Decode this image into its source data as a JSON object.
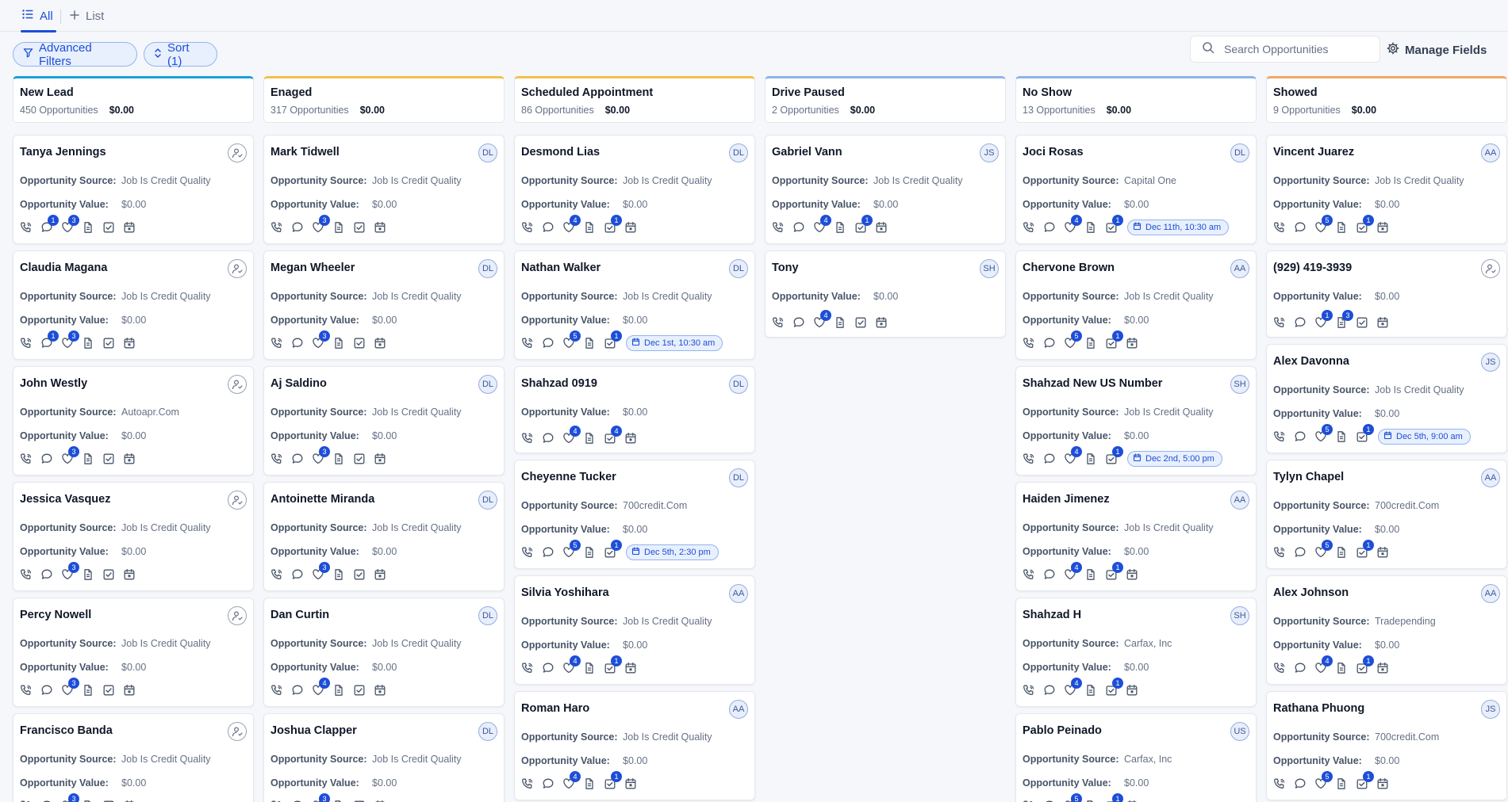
{
  "tabs": [
    {
      "label": "All",
      "icon": "list-icon",
      "active": true
    },
    {
      "label": "List",
      "icon": "plus-icon",
      "active": false
    }
  ],
  "toolbar": {
    "filters_label": "Advanced Filters",
    "sort_label": "Sort (1)",
    "search_placeholder": "Search Opportunities",
    "manage_label": "Manage Fields"
  },
  "labels": {
    "source": "Opportunity Source:",
    "value": "Opportunity Value:"
  },
  "colors": {
    "accent": "#1d4ed8",
    "badge": "#1d4ed8"
  },
  "columns": [
    {
      "title": "New Lead",
      "count": "450 Opportunities",
      "amount": "$0.00",
      "color": "#1aa0d8",
      "cards": [
        {
          "name": "Tanya Jennings",
          "avatar": "",
          "source": "Job Is Credit Quality",
          "value": "$0.00",
          "icons": [
            "phone",
            "chat:1",
            "heart:3",
            "doc",
            "check",
            "calendar"
          ]
        },
        {
          "name": "Claudia Magana",
          "avatar": "",
          "source": "Job Is Credit Quality",
          "value": "$0.00",
          "icons": [
            "phone",
            "chat:1",
            "heart:3",
            "doc",
            "check",
            "calendar"
          ]
        },
        {
          "name": "John Westly",
          "avatar": "",
          "source": "Autoapr.Com",
          "value": "$0.00",
          "icons": [
            "phone",
            "chat",
            "heart:3",
            "doc",
            "check",
            "calendar"
          ]
        },
        {
          "name": "Jessica Vasquez",
          "avatar": "",
          "source": "Job Is Credit Quality",
          "value": "$0.00",
          "icons": [
            "phone",
            "chat",
            "heart:3",
            "doc",
            "check",
            "calendar"
          ]
        },
        {
          "name": "Percy Nowell",
          "avatar": "",
          "source": "Job Is Credit Quality",
          "value": "$0.00",
          "icons": [
            "phone",
            "chat",
            "heart:3",
            "doc",
            "check",
            "calendar"
          ]
        },
        {
          "name": "Francisco Banda",
          "avatar": "",
          "source": "Job Is Credit Quality",
          "value": "$0.00",
          "icons": [
            "phone",
            "chat",
            "heart:3",
            "doc",
            "check",
            "calendar"
          ]
        }
      ]
    },
    {
      "title": "Enaged",
      "count": "317 Opportunities",
      "amount": "$0.00",
      "color": "#f2c14e",
      "cards": [
        {
          "name": "Mark Tidwell",
          "avatar": "DL",
          "source": "Job Is Credit Quality",
          "value": "$0.00",
          "icons": [
            "phone",
            "chat",
            "heart:3",
            "doc",
            "check",
            "calendar"
          ]
        },
        {
          "name": "Megan Wheeler",
          "avatar": "DL",
          "source": "Job Is Credit Quality",
          "value": "$0.00",
          "icons": [
            "phone",
            "chat",
            "heart:3",
            "doc",
            "check",
            "calendar"
          ]
        },
        {
          "name": "Aj Saldino",
          "avatar": "DL",
          "source": "Job Is Credit Quality",
          "value": "$0.00",
          "icons": [
            "phone",
            "chat",
            "heart:3",
            "doc",
            "check",
            "calendar"
          ]
        },
        {
          "name": "Antoinette Miranda",
          "avatar": "DL",
          "source": "Job Is Credit Quality",
          "value": "$0.00",
          "icons": [
            "phone",
            "chat",
            "heart:3",
            "doc",
            "check",
            "calendar"
          ]
        },
        {
          "name": "Dan Curtin",
          "avatar": "DL",
          "source": "Job Is Credit Quality",
          "value": "$0.00",
          "icons": [
            "phone",
            "chat",
            "heart:4",
            "doc",
            "check",
            "calendar"
          ]
        },
        {
          "name": "Joshua Clapper",
          "avatar": "DL",
          "source": "Job Is Credit Quality",
          "value": "$0.00",
          "icons": [
            "phone",
            "chat",
            "heart:3",
            "doc",
            "check",
            "calendar"
          ]
        }
      ]
    },
    {
      "title": "Scheduled Appointment",
      "count": "86 Opportunities",
      "amount": "$0.00",
      "color": "#f2c14e",
      "cards": [
        {
          "name": "Desmond Lias",
          "avatar": "DL",
          "source": "Job Is Credit Quality",
          "value": "$0.00",
          "icons": [
            "phone",
            "chat",
            "heart:4",
            "doc",
            "task:1",
            "calendar"
          ]
        },
        {
          "name": "Nathan Walker",
          "avatar": "DL",
          "source": "Job Is Credit Quality",
          "value": "$0.00",
          "icons": [
            "phone",
            "chat",
            "heart:5",
            "doc",
            "task:1"
          ],
          "appt": "Dec 1st, 10:30 am"
        },
        {
          "name": "Shahzad 0919",
          "avatar": "DL",
          "value": "$0.00",
          "icons": [
            "phone",
            "chat",
            "heart:4",
            "doc",
            "task:4",
            "calendar"
          ]
        },
        {
          "name": "Cheyenne Tucker",
          "avatar": "DL",
          "source": "700credit.Com",
          "value": "$0.00",
          "icons": [
            "phone",
            "chat",
            "heart:5",
            "doc",
            "task:1"
          ],
          "appt": "Dec 5th, 2:30 pm"
        },
        {
          "name": "Silvia Yoshihara",
          "avatar": "AA",
          "source": "Job Is Credit Quality",
          "value": "$0.00",
          "icons": [
            "phone",
            "chat",
            "heart:4",
            "doc",
            "task:1",
            "calendar"
          ]
        },
        {
          "name": "Roman Haro",
          "avatar": "AA",
          "source": "Job Is Credit Quality",
          "value": "$0.00",
          "icons": [
            "phone",
            "chat",
            "heart:4",
            "doc",
            "task:1",
            "calendar"
          ]
        }
      ]
    },
    {
      "title": "Drive Paused",
      "count": "2 Opportunities",
      "amount": "$0.00",
      "color": "#8fb4e8",
      "cards": [
        {
          "name": "Gabriel Vann",
          "avatar": "JS",
          "source": "Job Is Credit Quality",
          "value": "$0.00",
          "icons": [
            "phone",
            "chat",
            "heart:4",
            "doc",
            "task:1",
            "calendar"
          ]
        },
        {
          "name": "Tony",
          "avatar": "SH",
          "value": "$0.00",
          "icons": [
            "phone",
            "chat",
            "heart:4",
            "doc",
            "check",
            "calendar"
          ]
        }
      ]
    },
    {
      "title": "No Show",
      "count": "13 Opportunities",
      "amount": "$0.00",
      "color": "#8fb4e8",
      "cards": [
        {
          "name": "Joci Rosas",
          "avatar": "DL",
          "source": "Capital One",
          "value": "$0.00",
          "icons": [
            "phone",
            "chat",
            "heart:4",
            "doc",
            "task:1"
          ],
          "appt": "Dec 11th, 10:30 am"
        },
        {
          "name": "Chervone Brown",
          "avatar": "AA",
          "source": "Job Is Credit Quality",
          "value": "$0.00",
          "icons": [
            "phone",
            "chat",
            "heart:5",
            "doc",
            "task:1",
            "calendar"
          ]
        },
        {
          "name": "Shahzad New US Number",
          "avatar": "SH",
          "source": "Job Is Credit Quality",
          "value": "$0.00",
          "icons": [
            "phone",
            "chat",
            "heart:4",
            "doc",
            "task:1"
          ],
          "appt": "Dec 2nd, 5:00 pm"
        },
        {
          "name": "Haiden Jimenez",
          "avatar": "AA",
          "source": "Job Is Credit Quality",
          "value": "$0.00",
          "icons": [
            "phone",
            "chat",
            "heart:4",
            "doc",
            "task:1",
            "calendar"
          ]
        },
        {
          "name": "Shahzad H",
          "avatar": "SH",
          "source": "Carfax, Inc",
          "value": "$0.00",
          "icons": [
            "phone",
            "chat",
            "heart:4",
            "doc",
            "task:1",
            "calendar"
          ]
        },
        {
          "name": "Pablo Peinado",
          "avatar": "US",
          "source": "Carfax, Inc",
          "value": "$0.00",
          "icons": [
            "phone",
            "chat",
            "heart:5",
            "doc",
            "task:1",
            "calendar"
          ]
        }
      ]
    },
    {
      "title": "Showed",
      "count": "9 Opportunities",
      "amount": "$0.00",
      "color": "#f0a868",
      "cards": [
        {
          "name": "Vincent Juarez",
          "avatar": "AA",
          "source": "Job Is Credit Quality",
          "value": "$0.00",
          "icons": [
            "phone",
            "chat",
            "heart:5",
            "doc",
            "task:1",
            "calendar"
          ]
        },
        {
          "name": "(929) 419-3939",
          "avatar": "",
          "value": "$0.00",
          "icons": [
            "phone",
            "chat",
            "heart:1",
            "doc:3",
            "check",
            "calendar"
          ]
        },
        {
          "name": "Alex Davonna",
          "avatar": "JS",
          "source": "Job Is Credit Quality",
          "value": "$0.00",
          "icons": [
            "phone",
            "chat",
            "heart:5",
            "doc",
            "task:1"
          ],
          "appt": "Dec 5th, 9:00 am"
        },
        {
          "name": "Tylyn Chapel",
          "avatar": "AA",
          "source": "700credit.Com",
          "value": "$0.00",
          "icons": [
            "phone",
            "chat",
            "heart:5",
            "doc",
            "task:1",
            "calendar"
          ]
        },
        {
          "name": "Alex Johnson",
          "avatar": "AA",
          "source": "Tradepending",
          "value": "$0.00",
          "icons": [
            "phone",
            "chat",
            "heart:4",
            "doc",
            "task:1",
            "calendar"
          ]
        },
        {
          "name": "Rathana Phuong",
          "avatar": "JS",
          "source": "700credit.Com",
          "value": "$0.00",
          "icons": [
            "phone",
            "chat",
            "heart:5",
            "doc",
            "task:1",
            "calendar"
          ]
        }
      ]
    }
  ]
}
